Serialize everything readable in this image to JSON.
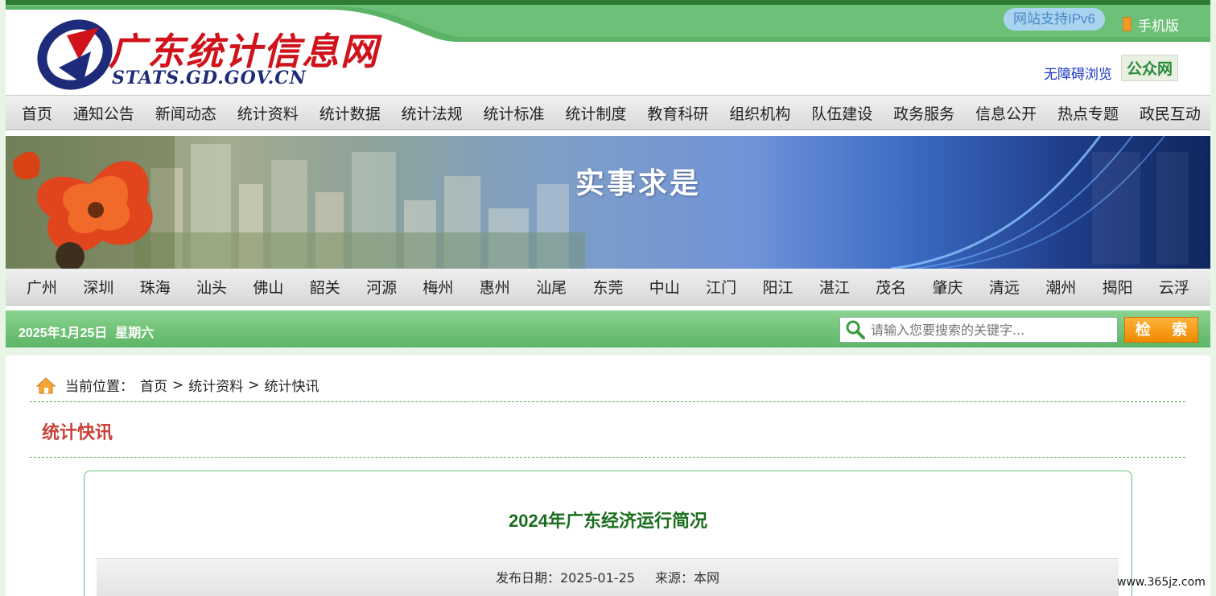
{
  "header": {
    "site_title": "广东统计信息网",
    "site_domain": "STATS.GD.GOV.CN",
    "ipv6": "网站支持IPv6",
    "mobile": "手机版",
    "accessibility": "无障碍浏览",
    "wechat": "公众网"
  },
  "nav": [
    {
      "label": "首页"
    },
    {
      "label": "通知公告"
    },
    {
      "label": "新闻动态"
    },
    {
      "label": "统计资料"
    },
    {
      "label": "统计数据"
    },
    {
      "label": "统计法规"
    },
    {
      "label": "统计标准"
    },
    {
      "label": "统计制度"
    },
    {
      "label": "教育科研"
    },
    {
      "label": "组织机构"
    },
    {
      "label": "队伍建设"
    },
    {
      "label": "政务服务"
    },
    {
      "label": "信息公开"
    },
    {
      "label": "热点专题"
    },
    {
      "label": "政民互动"
    }
  ],
  "banner": {
    "slogan": "实事求是"
  },
  "cities": [
    {
      "label": "广州"
    },
    {
      "label": "深圳"
    },
    {
      "label": "珠海"
    },
    {
      "label": "汕头"
    },
    {
      "label": "佛山"
    },
    {
      "label": "韶关"
    },
    {
      "label": "河源"
    },
    {
      "label": "梅州"
    },
    {
      "label": "惠州"
    },
    {
      "label": "汕尾"
    },
    {
      "label": "东莞"
    },
    {
      "label": "中山"
    },
    {
      "label": "江门"
    },
    {
      "label": "阳江"
    },
    {
      "label": "湛江"
    },
    {
      "label": "茂名"
    },
    {
      "label": "肇庆"
    },
    {
      "label": "清远"
    },
    {
      "label": "潮州"
    },
    {
      "label": "揭阳"
    },
    {
      "label": "云浮"
    }
  ],
  "datebar": {
    "date": "2025年1月25日",
    "weekday": "星期六",
    "search_placeholder": "请输入您要搜索的关键字...",
    "search_button": "检 索"
  },
  "breadcrumb": {
    "prefix": "当前位置：",
    "items": [
      "首页",
      "统计资料",
      "统计快讯"
    ],
    "separator": ">"
  },
  "section_title": "统计快讯",
  "article": {
    "title": "2024年广东经济运行简况",
    "publish_label": "发布日期：2025-01-25",
    "source_label": "来源：本网"
  },
  "watermark": "www.365jz.com",
  "colors": {
    "brand_green": "#2e7d32",
    "title_red": "#c8423a",
    "article_title": "#1a6e1e",
    "search_button": "#f08a00"
  }
}
